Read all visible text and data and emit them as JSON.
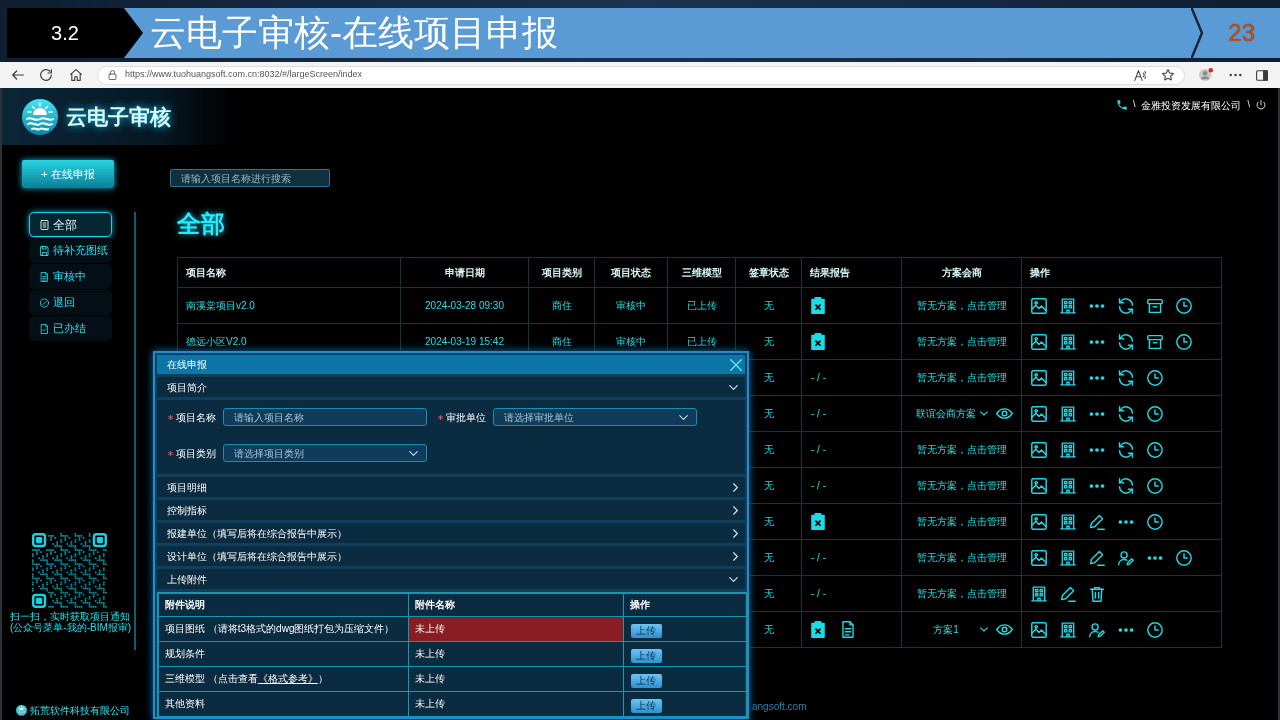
{
  "slide": {
    "section": "3.2",
    "title": "云电子审核-在线项目申报",
    "page": "23"
  },
  "browser": {
    "url": "https://www.tuohuangsoft.com.cn:8032/#/largeScreen/index"
  },
  "header": {
    "brand": "云电子审核",
    "user_bar": {
      "divider_left": "\\",
      "company": "金雅投资发展有限公司",
      "divider_right": "\\"
    }
  },
  "sidebar": {
    "new_button": "+ 在线申报",
    "menu": [
      {
        "label": "全部",
        "selected": true
      },
      {
        "label": "待补充图纸",
        "selected": false
      },
      {
        "label": "审核中",
        "selected": false
      },
      {
        "label": "退回",
        "selected": false
      },
      {
        "label": "已办结",
        "selected": false
      }
    ],
    "qr_caption": [
      "扫一扫，实时获取项目通知",
      "(公众号菜单-我的-BIM报审)"
    ],
    "footer": "拓荒软件科技有限公司"
  },
  "main": {
    "search": {
      "placeholder": "请输入项目名称进行搜索"
    },
    "heading": "全部",
    "table": {
      "columns": [
        "项目名称",
        "申请日期",
        "项目类别",
        "项目状态",
        "三维模型",
        "签章状态",
        "结果报告",
        "方案会商",
        "操作"
      ],
      "rows": [
        {
          "name": "南溪棠项目v2.0",
          "date": "2024-03-28 09:30",
          "category": "商住",
          "status": "审核中",
          "model": "已上传",
          "signature": "无",
          "report": [
            {
              "kind": "clipboard-x"
            }
          ],
          "plan": {
            "kind": "link",
            "text": "暂无方案，点击管理"
          },
          "actions": [
            {
              "kind": "image"
            },
            {
              "kind": "building"
            },
            {
              "kind": "more"
            },
            {
              "kind": "refresh"
            },
            {
              "kind": "archive"
            },
            {
              "kind": "clock"
            }
          ]
        },
        {
          "name": "德远小区V2.0",
          "date": "2024-03-19 15:42",
          "category": "商住",
          "status": "审核中",
          "model": "已上传",
          "signature": "无",
          "report": [
            {
              "kind": "clipboard-x"
            }
          ],
          "plan": {
            "kind": "link",
            "text": "暂无方案，点击管理"
          },
          "actions": [
            {
              "kind": "image"
            },
            {
              "kind": "building"
            },
            {
              "kind": "more"
            },
            {
              "kind": "refresh"
            },
            {
              "kind": "archive"
            },
            {
              "kind": "clock"
            }
          ]
        },
        {
          "signature": "无",
          "report": [
            {
              "kind": "text",
              "text": "- / -"
            }
          ],
          "plan": {
            "kind": "link",
            "text": "暂无方案，点击管理"
          },
          "actions": [
            {
              "kind": "image"
            },
            {
              "kind": "building"
            },
            {
              "kind": "more"
            },
            {
              "kind": "refresh"
            },
            {
              "kind": "clock"
            }
          ]
        },
        {
          "signature": "无",
          "report": [
            {
              "kind": "text",
              "text": "- / -"
            }
          ],
          "plan": {
            "kind": "select",
            "text": "联谊会商方案"
          },
          "actions": [
            {
              "kind": "image"
            },
            {
              "kind": "building"
            },
            {
              "kind": "more"
            },
            {
              "kind": "refresh"
            },
            {
              "kind": "clock"
            }
          ]
        },
        {
          "signature": "无",
          "report": [
            {
              "kind": "text",
              "text": "- / -"
            }
          ],
          "plan": {
            "kind": "link",
            "text": "暂无方案，点击管理"
          },
          "actions": [
            {
              "kind": "image"
            },
            {
              "kind": "building"
            },
            {
              "kind": "more"
            },
            {
              "kind": "refresh"
            },
            {
              "kind": "clock"
            }
          ]
        },
        {
          "signature": "无",
          "report": [
            {
              "kind": "text",
              "text": "- / -"
            }
          ],
          "plan": {
            "kind": "link",
            "text": "暂无方案，点击管理"
          },
          "actions": [
            {
              "kind": "image"
            },
            {
              "kind": "building"
            },
            {
              "kind": "more"
            },
            {
              "kind": "refresh"
            },
            {
              "kind": "clock"
            }
          ]
        },
        {
          "signature": "无",
          "report": [
            {
              "kind": "clipboard-x"
            }
          ],
          "plan": {
            "kind": "link",
            "text": "暂无方案，点击管理"
          },
          "actions": [
            {
              "kind": "image"
            },
            {
              "kind": "building"
            },
            {
              "kind": "pencil"
            },
            {
              "kind": "more"
            },
            {
              "kind": "clock"
            }
          ]
        },
        {
          "signature": "无",
          "report": [
            {
              "kind": "text",
              "text": "- / -"
            }
          ],
          "plan": {
            "kind": "link",
            "text": "暂无方案，点击管理"
          },
          "actions": [
            {
              "kind": "image"
            },
            {
              "kind": "building"
            },
            {
              "kind": "pencil"
            },
            {
              "kind": "user-edit"
            },
            {
              "kind": "more"
            },
            {
              "kind": "clock"
            }
          ]
        },
        {
          "signature": "无",
          "report": [
            {
              "kind": "text",
              "text": "- / -"
            }
          ],
          "plan": {
            "kind": "link",
            "text": "暂无方案，点击管理"
          },
          "actions": [
            {
              "kind": "building"
            },
            {
              "kind": "pencil"
            },
            {
              "kind": "trash"
            }
          ]
        },
        {
          "signature": "无",
          "report": [
            {
              "kind": "clipboard-x"
            },
            {
              "kind": "document"
            }
          ],
          "plan": {
            "kind": "select",
            "text": "方案1"
          },
          "actions": [
            {
              "kind": "image"
            },
            {
              "kind": "building"
            },
            {
              "kind": "user-edit"
            },
            {
              "kind": "more"
            },
            {
              "kind": "clock"
            }
          ]
        }
      ]
    },
    "footer": "angsoft.com"
  },
  "dialog": {
    "title": "在线申报",
    "sections": [
      {
        "title": "项目简介",
        "expanded": true,
        "fields": [
          {
            "label": "项目名称",
            "required": true,
            "kind": "input",
            "placeholder": "请输入项目名称"
          },
          {
            "label": "审批单位",
            "required": true,
            "kind": "select",
            "placeholder": "请选择审批单位"
          },
          {
            "label": "项目类别",
            "required": true,
            "kind": "select",
            "placeholder": "请选择项目类别"
          }
        ]
      },
      {
        "title": "项目明细",
        "expanded": false
      },
      {
        "title": "控制指标",
        "expanded": false
      },
      {
        "title": "报建单位（填写后将在综合报告中展示）",
        "expanded": false
      },
      {
        "title": "设计单位（填写后将在综合报告中展示）",
        "expanded": false
      },
      {
        "title": "上传附件",
        "expanded": true,
        "table": {
          "columns": [
            "附件说明",
            "附件名称",
            "操作"
          ],
          "rows": [
            {
              "description": "项目图纸 （请将t3格式的dwg图纸打包为压缩文件）",
              "file": "未上传",
              "error": true,
              "button": "上传"
            },
            {
              "description": "规划条件",
              "file": "未上传",
              "error": false,
              "button": "上传"
            },
            {
              "description": "三维模型 （点击查看",
              "link": "《格式参考》",
              "description_end": "）",
              "file": "未上传",
              "error": false,
              "button": "上传"
            },
            {
              "description": "其他资料",
              "file": "未上传",
              "error": false,
              "button": "上传"
            }
          ]
        }
      }
    ]
  }
}
